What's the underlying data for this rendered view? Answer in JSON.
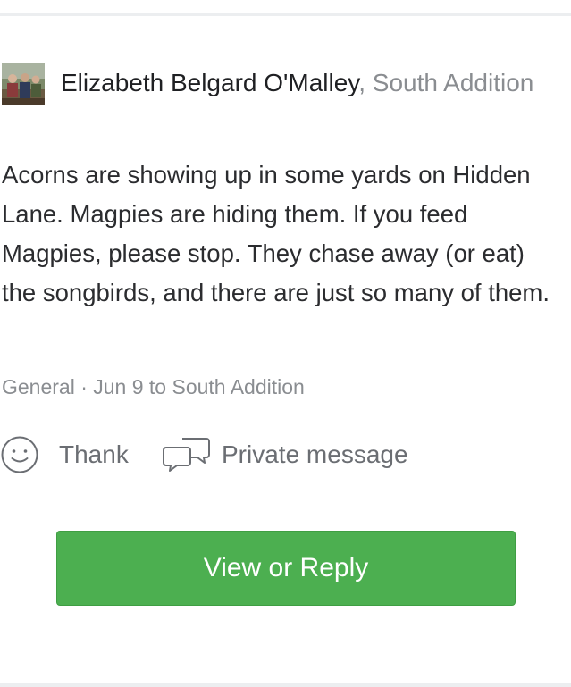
{
  "post": {
    "author": "Elizabeth Belgard O'Malley",
    "neighborhood": ", South Addition",
    "body": "Acorns are showing up in some yards on Hidden Lane. Magpies are hiding them. If you feed Magpies, please stop. They chase away (or eat) the songbirds, and there are just so many of them.",
    "meta": "General · Jun 9 to South Addition"
  },
  "actions": {
    "thank_label": "Thank",
    "thank_icon": "smiley-icon",
    "private_message_label": "Private message",
    "private_message_icon": "chat-bubbles-icon"
  },
  "cta": {
    "label": "View or Reply",
    "color": "#4caf50"
  },
  "colors": {
    "text": "#2b2c2f",
    "muted": "#8a8d91",
    "divider": "#eceef0"
  }
}
